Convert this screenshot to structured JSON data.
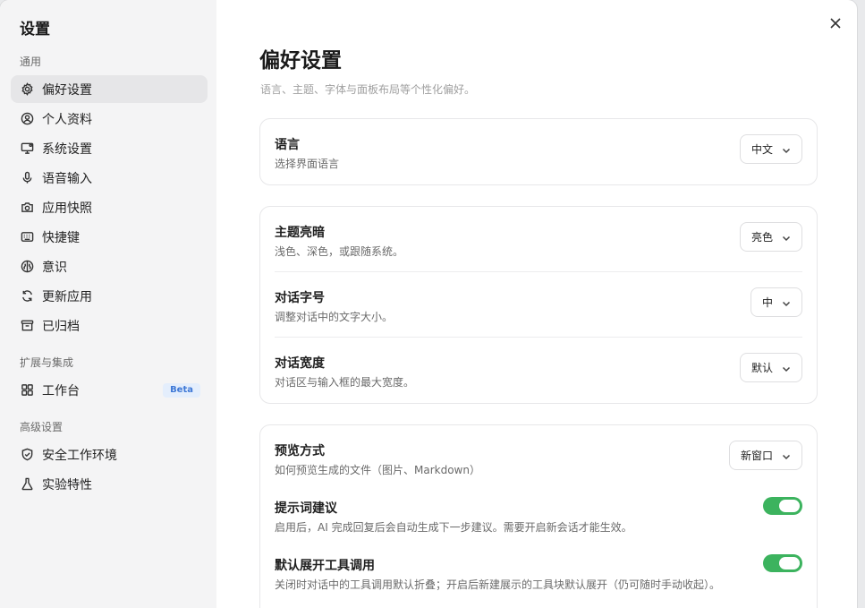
{
  "sidebar": {
    "title": "设置",
    "sections": [
      {
        "label": "通用"
      },
      {
        "label": "扩展与集成"
      },
      {
        "label": "高级设置"
      }
    ],
    "items": [
      {
        "label": "偏好设置",
        "icon": "gear-icon"
      },
      {
        "label": "个人资料",
        "icon": "user-circle-icon"
      },
      {
        "label": "系统设置",
        "icon": "monitor-icon"
      },
      {
        "label": "语音输入",
        "icon": "microphone-icon"
      },
      {
        "label": "应用快照",
        "icon": "camera-icon"
      },
      {
        "label": "快捷键",
        "icon": "keyboard-icon"
      },
      {
        "label": "意识",
        "icon": "brain-icon"
      },
      {
        "label": "更新应用",
        "icon": "refresh-icon"
      },
      {
        "label": "已归档",
        "icon": "archive-icon"
      },
      {
        "label": "工作台",
        "icon": "grid-icon",
        "badge": "Beta"
      },
      {
        "label": "安全工作环境",
        "icon": "shield-icon"
      },
      {
        "label": "实验特性",
        "icon": "flask-icon"
      }
    ]
  },
  "main": {
    "title": "偏好设置",
    "description": "语言、主题、字体与面板布局等个性化偏好。",
    "language": {
      "label": "语言",
      "sub": "选择界面语言",
      "value": "中文"
    },
    "theme": {
      "label": "主题亮暗",
      "sub": "浅色、深色，或跟随系统。",
      "value": "亮色"
    },
    "font_size": {
      "label": "对话字号",
      "sub": "调整对话中的文字大小。",
      "value": "中"
    },
    "width": {
      "label": "对话宽度",
      "sub": "对话区与输入框的最大宽度。",
      "value": "默认"
    },
    "preview": {
      "label": "预览方式",
      "sub": "如何预览生成的文件（图片、Markdown）",
      "value": "新窗口"
    },
    "prompt_suggest": {
      "label": "提示词建议",
      "sub": "启用后，AI 完成回复后会自动生成下一步建议。需要开启新会话才能生效。",
      "enabled": true
    },
    "expand_tools": {
      "label": "默认展开工具调用",
      "sub": "关闭时对话中的工具调用默认折叠；开启后新建展示的工具块默认展开（仍可随时手动收起）。",
      "enabled": true
    }
  },
  "colors": {
    "accent_toggle": "#3cb35e",
    "beta_badge": "#3e78d6"
  }
}
